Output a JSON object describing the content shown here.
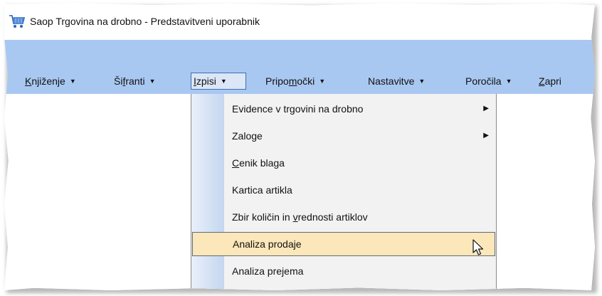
{
  "window": {
    "title": "Saop Trgovina na drobno - Predstavitveni uporabnik",
    "icon": "shopping-cart-icon"
  },
  "menubar": {
    "items": [
      {
        "pre": "",
        "u": "K",
        "post": "njiženje"
      },
      {
        "pre": "Ši",
        "u": "f",
        "post": "ranti"
      },
      {
        "pre": "",
        "u": "I",
        "post": "zpisi"
      },
      {
        "pre": "Pripo",
        "u": "m",
        "post": "očki"
      },
      {
        "pre": "Nastavitve",
        "u": "",
        "post": ""
      },
      {
        "pre": "Poročila",
        "u": "",
        "post": ""
      },
      {
        "pre": "",
        "u": "Z",
        "post": "apri"
      }
    ],
    "open_item": "Izpisi"
  },
  "dropdown": {
    "items": [
      {
        "pre": "Evidence v trgovini na drobno",
        "u": "",
        "post": "",
        "submenu": true
      },
      {
        "pre": "Zaloge",
        "u": "",
        "post": "",
        "submenu": true
      },
      {
        "pre": "",
        "u": "C",
        "post": "enik blaga",
        "submenu": false
      },
      {
        "pre": "Kartica artikla",
        "u": "",
        "post": "",
        "submenu": false
      },
      {
        "pre": "Zbir količin in ",
        "u": "v",
        "post": "rednosti artiklov",
        "submenu": false
      },
      {
        "pre": "Analiza prodaje",
        "u": "",
        "post": "",
        "submenu": false
      },
      {
        "pre": "Analiza prejema",
        "u": "",
        "post": "",
        "submenu": false
      }
    ],
    "hovered": "Analiza prodaje"
  },
  "colors": {
    "menubar": "#a9c8f1",
    "open_menu": "#dbe6f6",
    "hover_item": "#fbe7b9",
    "dropdown_bg": "#f2f2f2"
  }
}
